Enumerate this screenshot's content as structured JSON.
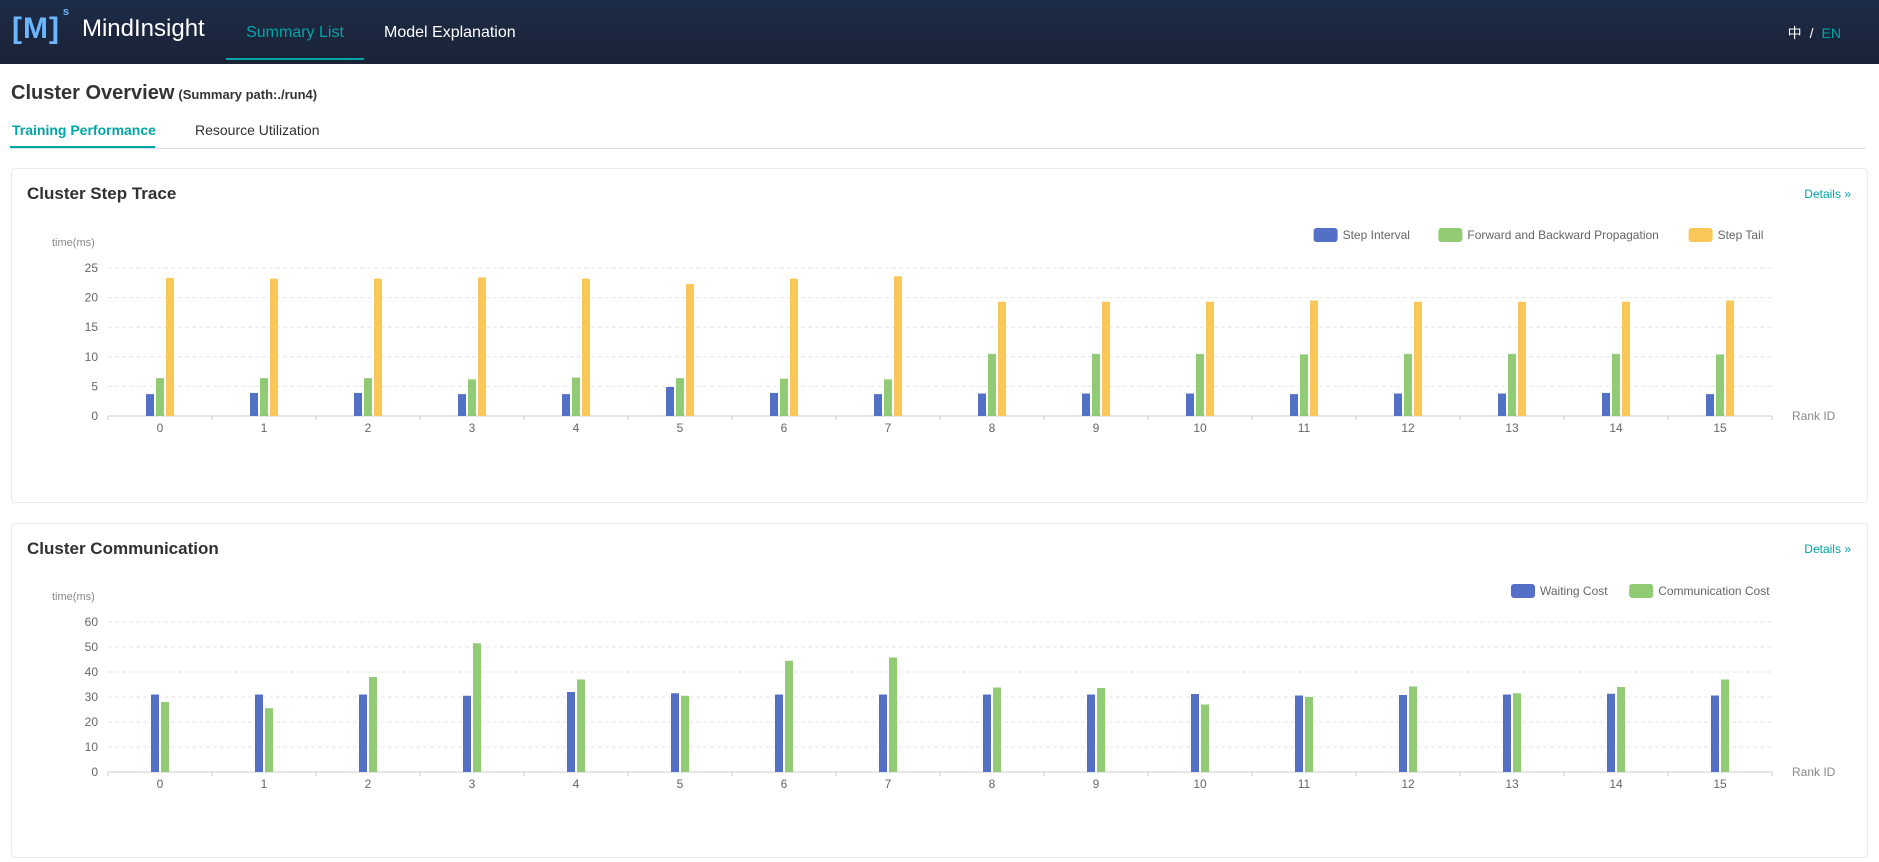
{
  "header": {
    "logo_mark": "[M]",
    "logo_sup": "s",
    "app_name": "MindInsight",
    "nav": [
      {
        "label": "Summary List",
        "active": true
      },
      {
        "label": "Model Explanation",
        "active": false
      }
    ],
    "lang_zh": "中",
    "lang_sep": "/",
    "lang_en": "EN"
  },
  "page": {
    "title": "Cluster Overview",
    "subtitle": "(Summary path:./run4)"
  },
  "tabs": [
    {
      "label": "Training Performance",
      "active": true
    },
    {
      "label": "Resource Utilization",
      "active": false
    }
  ],
  "colors": {
    "accent": "#00a5a7",
    "blue": "#5470c6",
    "green": "#91cc75",
    "yellow": "#fac858"
  },
  "step_trace": {
    "title": "Cluster Step Trace",
    "details": "Details"
  },
  "communication": {
    "title": "Cluster Communication",
    "details": "Details"
  },
  "chart_data": [
    {
      "type": "bar",
      "ylabel": "time(ms)",
      "xlabel": "Rank ID",
      "ylim": [
        0,
        25
      ],
      "yticks": [
        0,
        5,
        10,
        15,
        20,
        25
      ],
      "legend_position": "top-right",
      "grid": true,
      "categories": [
        "0",
        "1",
        "2",
        "3",
        "4",
        "5",
        "6",
        "7",
        "8",
        "9",
        "10",
        "11",
        "12",
        "13",
        "14",
        "15"
      ],
      "series": [
        {
          "name": "Step Interval",
          "color": "#5470c6",
          "values": [
            3.7,
            3.9,
            3.9,
            3.7,
            3.7,
            4.9,
            3.9,
            3.7,
            3.8,
            3.8,
            3.8,
            3.7,
            3.8,
            3.8,
            3.9,
            3.7
          ]
        },
        {
          "name": "Forward and Backward Propagation",
          "color": "#91cc75",
          "values": [
            6.4,
            6.4,
            6.4,
            6.2,
            6.5,
            6.4,
            6.3,
            6.2,
            10.5,
            10.5,
            10.5,
            10.4,
            10.5,
            10.5,
            10.5,
            10.4
          ]
        },
        {
          "name": "Step Tail",
          "color": "#fac858",
          "values": [
            23.3,
            23.2,
            23.2,
            23.4,
            23.2,
            22.3,
            23.2,
            23.6,
            19.3,
            19.3,
            19.3,
            19.5,
            19.3,
            19.3,
            19.3,
            19.5
          ]
        }
      ]
    },
    {
      "type": "bar",
      "ylabel": "time(ms)",
      "xlabel": "Rank ID",
      "ylim": [
        0,
        60
      ],
      "yticks": [
        0,
        10,
        20,
        30,
        40,
        50,
        60
      ],
      "legend_position": "top-right",
      "grid": true,
      "categories": [
        "0",
        "1",
        "2",
        "3",
        "4",
        "5",
        "6",
        "7",
        "8",
        "9",
        "10",
        "11",
        "12",
        "13",
        "14",
        "15"
      ],
      "series": [
        {
          "name": "Waiting Cost",
          "color": "#5470c6",
          "values": [
            31,
            31,
            31,
            30.5,
            32,
            31.5,
            31,
            31,
            31,
            31,
            31.2,
            30.6,
            30.8,
            31,
            31.3,
            30.6
          ]
        },
        {
          "name": "Communication Cost",
          "color": "#91cc75",
          "values": [
            28,
            25.5,
            38,
            51.5,
            37,
            30.5,
            44.5,
            45.8,
            33.8,
            33.6,
            27,
            30,
            34.2,
            31.5,
            34,
            37
          ]
        }
      ]
    }
  ]
}
